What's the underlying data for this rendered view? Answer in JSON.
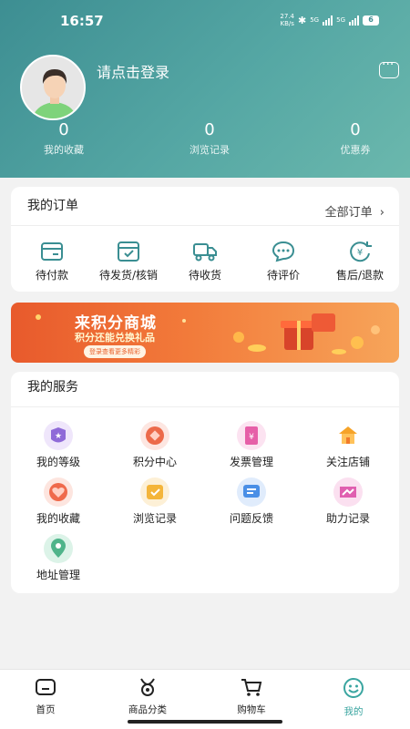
{
  "status_bar": {
    "time": "16:57",
    "net_speed_top": "27.4",
    "net_speed_unit": "KB/s",
    "signal_1": "5G",
    "signal_2": "5G",
    "battery": "6"
  },
  "profile": {
    "login_text": "请点击登录"
  },
  "stats": [
    {
      "value": "0",
      "label": "我的收藏"
    },
    {
      "value": "0",
      "label": "浏览记录"
    },
    {
      "value": "0",
      "label": "优惠券"
    }
  ],
  "orders": {
    "title": "我的订单",
    "all_label": "全部订单",
    "items": [
      {
        "label": "待付款",
        "icon": "wallet-icon"
      },
      {
        "label": "待发货/核销",
        "icon": "package-icon"
      },
      {
        "label": "待收货",
        "icon": "truck-icon"
      },
      {
        "label": "待评价",
        "icon": "chat-icon"
      },
      {
        "label": "售后/退款",
        "icon": "refund-icon"
      }
    ]
  },
  "banner": {
    "title": "来积分商城",
    "subtitle": "积分还能兑换礼品",
    "button": "登录查看更多精彩"
  },
  "services": {
    "title": "我的服务",
    "items": [
      {
        "label": "我的等级",
        "icon": "level-icon",
        "color": "#8f6ad8"
      },
      {
        "label": "积分中心",
        "icon": "points-icon",
        "color": "#ec6a4a"
      },
      {
        "label": "发票管理",
        "icon": "invoice-icon",
        "color": "#e65fa8"
      },
      {
        "label": "关注店铺",
        "icon": "store-icon",
        "color": "#f6a328"
      },
      {
        "label": "我的收藏",
        "icon": "favorite-icon",
        "color": "#ef6a4c"
      },
      {
        "label": "浏览记录",
        "icon": "history-icon",
        "color": "#f4b53a"
      },
      {
        "label": "问题反馈",
        "icon": "feedback-icon",
        "color": "#4a8fe6"
      },
      {
        "label": "助力记录",
        "icon": "assist-icon",
        "color": "#e05fb0"
      },
      {
        "label": "地址管理",
        "icon": "location-icon",
        "color": "#4fb48a"
      }
    ]
  },
  "tabbar": [
    {
      "label": "首页",
      "icon": "home-icon"
    },
    {
      "label": "商品分类",
      "icon": "category-icon"
    },
    {
      "label": "购物车",
      "icon": "cart-icon"
    },
    {
      "label": "我的",
      "icon": "smile-icon"
    }
  ],
  "colors": {
    "header": "#4f9fa0",
    "accent": "#3aa5a0",
    "banner": "#ee6b33"
  }
}
